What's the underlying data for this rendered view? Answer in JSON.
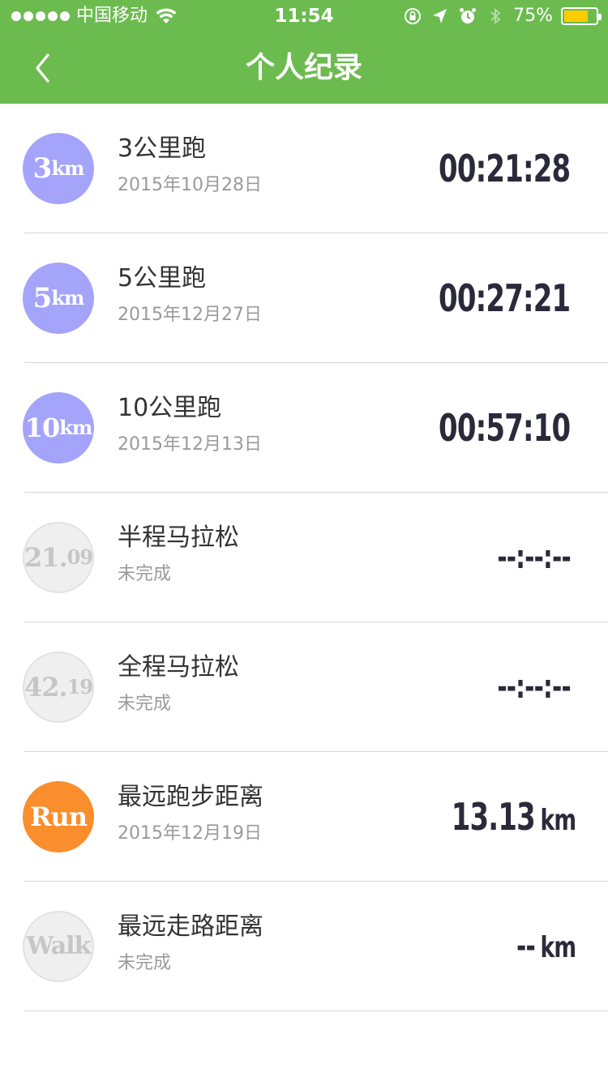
{
  "status_bar": {
    "carrier": "中国移动",
    "time": "11:54",
    "battery_pct": "75%",
    "battery_level": 0.75,
    "battery_color": "#ffcc00"
  },
  "nav": {
    "title": "个人纪录",
    "back_icon": "chevron-left-icon"
  },
  "records": [
    {
      "badge_main": "3",
      "badge_sub": "km",
      "badge_style": "blue",
      "title": "3公里跑",
      "date": "2015年10月28日",
      "value": "00:21:28",
      "unit": ""
    },
    {
      "badge_main": "5",
      "badge_sub": "km",
      "badge_style": "blue",
      "title": "5公里跑",
      "date": "2015年12月27日",
      "value": "00:27:21",
      "unit": ""
    },
    {
      "badge_main": "10",
      "badge_sub": "km",
      "badge_style": "blue",
      "title": "10公里跑",
      "date": "2015年12月13日",
      "value": "00:57:10",
      "unit": ""
    },
    {
      "badge_main": "21.",
      "badge_sub": "09",
      "badge_style": "gray",
      "title": "半程马拉松",
      "date": "未完成",
      "value": "--:--:--",
      "unit": ""
    },
    {
      "badge_main": "42.",
      "badge_sub": "19",
      "badge_style": "gray",
      "title": "全程马拉松",
      "date": "未完成",
      "value": "--:--:--",
      "unit": ""
    },
    {
      "badge_main": "Run",
      "badge_sub": "",
      "badge_style": "orange",
      "title": "最远跑步距离",
      "date": "2015年12月19日",
      "value": "13.13",
      "unit": "km"
    },
    {
      "badge_main": "Walk",
      "badge_sub": "",
      "badge_style": "gray",
      "title": "最远走路距离",
      "date": "未完成",
      "value": "--",
      "unit": "km"
    }
  ],
  "colors": {
    "header_green": "#6cbb4f",
    "badge_blue": "#a4a4fb",
    "badge_orange": "#fa8d2c",
    "badge_gray": "#efefef"
  }
}
